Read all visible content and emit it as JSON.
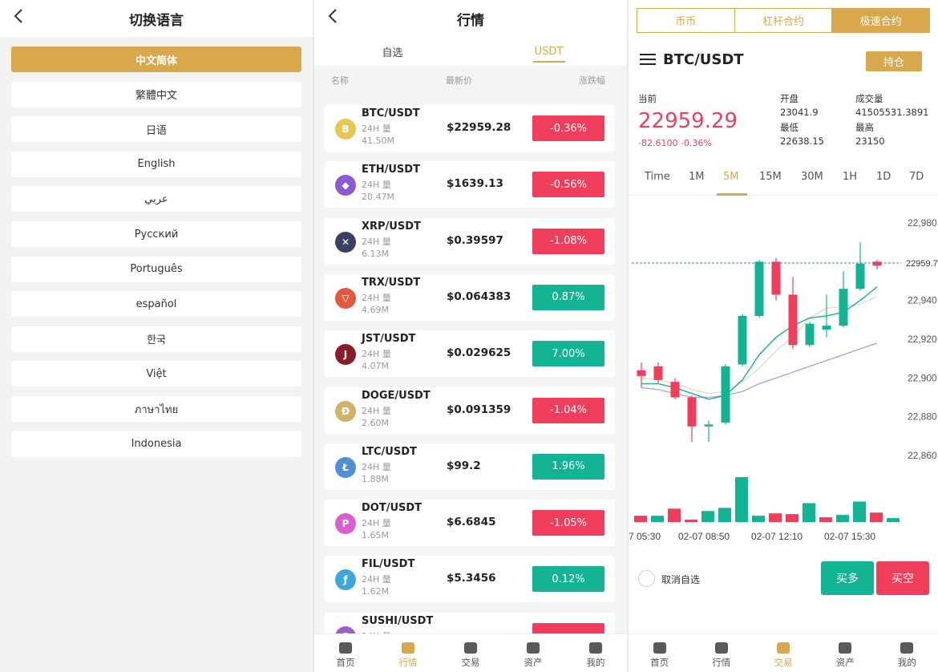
{
  "language": {
    "title": "切换语言",
    "items": [
      "中文简体",
      "繁體中文",
      "日语",
      "English",
      "عربي",
      "Русский",
      "Português",
      "español",
      "한국",
      "Việt",
      "ภาษาไทย",
      "Indonesia"
    ],
    "selected": "中文简体"
  },
  "market": {
    "title": "行情",
    "tabs": [
      "自选",
      "USDT"
    ],
    "active_tab": "USDT",
    "columns": {
      "name": "名称",
      "price": "最新价",
      "change": "涨跌幅"
    },
    "vol_label": "24H 量",
    "rows": [
      {
        "pair": "BTC/USDT",
        "vol": "41.50M",
        "price": "$22959.28",
        "change": "-0.36%",
        "dir": "dn",
        "icon": "btc-icon",
        "color": "#e7c84e",
        "glyph": "B"
      },
      {
        "pair": "ETH/USDT",
        "vol": "20.47M",
        "price": "$1639.13",
        "change": "-0.56%",
        "dir": "dn",
        "icon": "eth-icon",
        "color": "#8b5bd6",
        "glyph": "◆"
      },
      {
        "pair": "XRP/USDT",
        "vol": "6.13M",
        "price": "$0.39597",
        "change": "-1.08%",
        "dir": "dn",
        "icon": "xrp-icon",
        "color": "#3b3f62",
        "glyph": "✕"
      },
      {
        "pair": "TRX/USDT",
        "vol": "4.69M",
        "price": "$0.064383",
        "change": "0.87%",
        "dir": "up",
        "icon": "trx-icon",
        "color": "#e4583f",
        "glyph": "▽"
      },
      {
        "pair": "JST/USDT",
        "vol": "4.07M",
        "price": "$0.029625",
        "change": "7.00%",
        "dir": "up",
        "icon": "jst-icon",
        "color": "#8a1d27",
        "glyph": "J"
      },
      {
        "pair": "DOGE/USDT",
        "vol": "2.60M",
        "price": "$0.091359",
        "change": "-1.04%",
        "dir": "dn",
        "icon": "doge-icon",
        "color": "#cfb36a",
        "glyph": "Ð"
      },
      {
        "pair": "LTC/USDT",
        "vol": "1.88M",
        "price": "$99.2",
        "change": "1.96%",
        "dir": "up",
        "icon": "ltc-icon",
        "color": "#4e8fd6",
        "glyph": "Ł"
      },
      {
        "pair": "DOT/USDT",
        "vol": "1.65M",
        "price": "$6.6845",
        "change": "-1.05%",
        "dir": "dn",
        "icon": "dot-icon",
        "color": "#d95fd1",
        "glyph": "P"
      },
      {
        "pair": "FIL/USDT",
        "vol": "1.62M",
        "price": "$5.3456",
        "change": "0.12%",
        "dir": "up",
        "icon": "fil-icon",
        "color": "#3fa6db",
        "glyph": "ƒ"
      },
      {
        "pair": "SUSHI/USDT",
        "vol": "",
        "price": "",
        "change": "",
        "dir": "dn",
        "icon": "sushi-icon",
        "color": "#a05fc6",
        "glyph": "S"
      }
    ]
  },
  "nav": {
    "items": [
      {
        "label": "首页",
        "icon": "home-icon"
      },
      {
        "label": "行情",
        "icon": "chart-icon"
      },
      {
        "label": "交易",
        "icon": "trade-icon"
      },
      {
        "label": "资产",
        "icon": "wallet-icon"
      },
      {
        "label": "我的",
        "icon": "user-icon"
      }
    ]
  },
  "trade": {
    "segments": [
      "币币",
      "杠杆合约",
      "极速合约"
    ],
    "active_segment": "极速合约",
    "symbol": "BTC/USDT",
    "hold_button": "持仓",
    "current_label": "当前",
    "current_price": "22959.29",
    "change_text": "-82.6100 -0.36%",
    "stats": {
      "open_label": "开盘",
      "open": "23041.9",
      "low_label": "最低",
      "low": "22638.15",
      "volume_label": "成交量",
      "volume": "41505531.3891",
      "high_label": "最高",
      "high": "23150"
    },
    "timeframes": [
      "Time",
      "1M",
      "5M",
      "15M",
      "30M",
      "1H",
      "1D",
      "7D"
    ],
    "active_timeframe": "5M",
    "unfavorite_label": "取消自选",
    "buy_long": "买多",
    "buy_short": "买空",
    "colors": {
      "up": "#13b493",
      "down": "#ef3d5b",
      "accent": "#d9a84c"
    }
  },
  "chart_data": {
    "type": "candlestick",
    "y_ticks": [
      "22,980",
      "22,940",
      "22,920",
      "22,900",
      "22,880",
      "22,860"
    ],
    "x_ticks": [
      "7 05:30",
      "02-07 08:50",
      "02-07 12:10",
      "02-07 15:30"
    ],
    "last_price_label": "22959.7",
    "candles": [
      {
        "o": 22904,
        "h": 22908,
        "l": 22895,
        "c": 22901
      },
      {
        "o": 22906,
        "h": 22908,
        "l": 22897,
        "c": 22899
      },
      {
        "o": 22898,
        "h": 22900,
        "l": 22889,
        "c": 22890
      },
      {
        "o": 22890,
        "h": 22891,
        "l": 22867,
        "c": 22875
      },
      {
        "o": 22875,
        "h": 22878,
        "l": 22867,
        "c": 22876
      },
      {
        "o": 22877,
        "h": 22907,
        "l": 22876,
        "c": 22906
      },
      {
        "o": 22907,
        "h": 22933,
        "l": 22906,
        "c": 22932
      },
      {
        "o": 22932,
        "h": 22961,
        "l": 22931,
        "c": 22960
      },
      {
        "o": 22960,
        "h": 22962,
        "l": 22940,
        "c": 22943
      },
      {
        "o": 22943,
        "h": 22952,
        "l": 22915,
        "c": 22917
      },
      {
        "o": 22917,
        "h": 22929,
        "l": 22916,
        "c": 22928
      },
      {
        "o": 22925,
        "h": 22943,
        "l": 22921,
        "c": 22927
      },
      {
        "o": 22927,
        "h": 22955,
        "l": 22926,
        "c": 22946
      },
      {
        "o": 22946,
        "h": 22970,
        "l": 22945,
        "c": 22959
      },
      {
        "o": 22960,
        "h": 22961,
        "l": 22956,
        "c": 22958
      }
    ],
    "volumes": [
      8,
      8,
      17,
      3,
      14,
      18,
      57,
      8,
      11,
      10,
      24,
      6,
      9,
      26,
      12,
      5
    ],
    "ma_slow": [
      22895,
      22894,
      22892,
      22890,
      22890,
      22891,
      22893,
      22897,
      22900,
      22903,
      22906,
      22909,
      22912,
      22915,
      22918
    ],
    "ma_fast": [
      22897,
      22897,
      22895,
      22892,
      22889,
      22891,
      22899,
      22912,
      22921,
      22927,
      22931,
      22932,
      22934,
      22940,
      22947
    ],
    "ma_mid": [
      22900,
      22899,
      22897,
      22894,
      22892,
      22893,
      22898,
      22905,
      22914,
      22921,
      22931,
      22936,
      22937,
      22938,
      22942
    ]
  }
}
